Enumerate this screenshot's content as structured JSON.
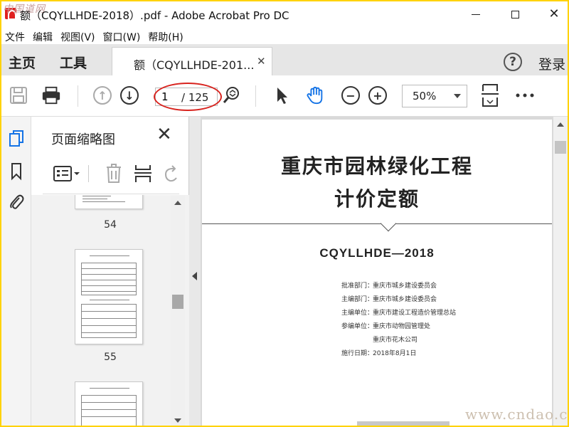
{
  "window": {
    "title": "额（CQYLLHDE-2018）.pdf - Adobe Acrobat Pro DC",
    "watermark_top": "中国道网"
  },
  "menu": [
    "文件",
    "编辑",
    "视图(V)",
    "窗口(W)",
    "帮助(H)"
  ],
  "tabs": {
    "home": "主页",
    "tools": "工具",
    "document": "额（CQYLLHDE-201...",
    "login": "登录"
  },
  "toolbar": {
    "page_current": "1",
    "page_total": "/ 125",
    "zoom": "50%"
  },
  "thumbnails": {
    "panel_title": "页面缩略图",
    "pages": [
      "54",
      "55"
    ]
  },
  "document": {
    "title_line1": "重庆市园林绿化工程",
    "title_line2": "计价定额",
    "code": "CQYLLHDE—2018",
    "info": [
      {
        "label": "批准部门：",
        "value": "重庆市城乡建设委员会"
      },
      {
        "label": "主编部门：",
        "value": "重庆市城乡建设委员会"
      },
      {
        "label": "主编单位：",
        "value": "重庆市建设工程造价管理总站"
      },
      {
        "label": "参编单位：",
        "value": "重庆市动物园管理处"
      },
      {
        "label": "",
        "value": "重庆市花木公司"
      },
      {
        "label": "施行日期：",
        "value": "2018年8月1日"
      }
    ]
  },
  "watermark_bottom": "www.cndao.com",
  "colors": {
    "frame": "#ffd200",
    "annotation_red": "#d8231e",
    "hand_tool_blue": "#1473e6"
  }
}
